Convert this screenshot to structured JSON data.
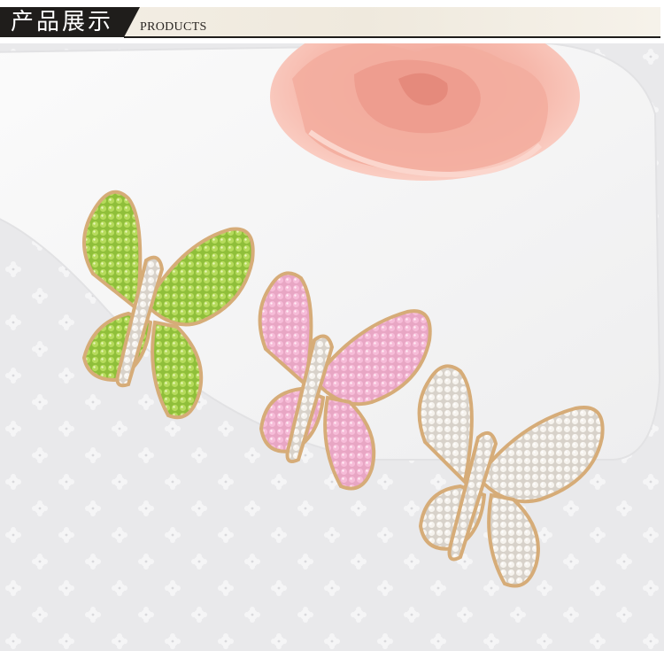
{
  "header": {
    "title": "产品展示",
    "subtitle": "PRODUCTS"
  },
  "colors": {
    "banner_dark": "#1f1d1b",
    "banner_light": "#f4efe6",
    "rose": "#f5b3a6",
    "gold": "#d9b07e",
    "green_stone": "#a9d24d",
    "pink_stone": "#f0a0c8",
    "clear_stone": "#f5f1ec"
  },
  "icons": {
    "rose": "rose-flower-icon",
    "brooch_green": "green-butterfly-brooch-icon",
    "brooch_pink": "pink-butterfly-brooch-icon",
    "brooch_clear": "clear-butterfly-brooch-icon"
  }
}
